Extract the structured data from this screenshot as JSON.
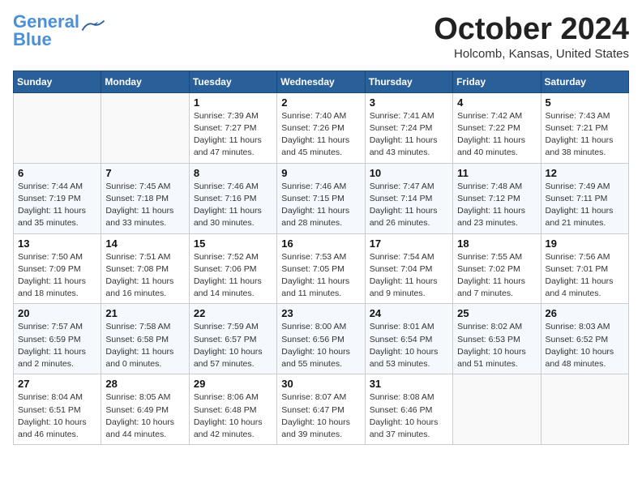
{
  "header": {
    "logo_line1": "General",
    "logo_line2": "Blue",
    "month": "October 2024",
    "location": "Holcomb, Kansas, United States"
  },
  "days_of_week": [
    "Sunday",
    "Monday",
    "Tuesday",
    "Wednesday",
    "Thursday",
    "Friday",
    "Saturday"
  ],
  "weeks": [
    [
      {
        "day": "",
        "info": ""
      },
      {
        "day": "",
        "info": ""
      },
      {
        "day": "1",
        "info": "Sunrise: 7:39 AM\nSunset: 7:27 PM\nDaylight: 11 hours and 47 minutes."
      },
      {
        "day": "2",
        "info": "Sunrise: 7:40 AM\nSunset: 7:26 PM\nDaylight: 11 hours and 45 minutes."
      },
      {
        "day": "3",
        "info": "Sunrise: 7:41 AM\nSunset: 7:24 PM\nDaylight: 11 hours and 43 minutes."
      },
      {
        "day": "4",
        "info": "Sunrise: 7:42 AM\nSunset: 7:22 PM\nDaylight: 11 hours and 40 minutes."
      },
      {
        "day": "5",
        "info": "Sunrise: 7:43 AM\nSunset: 7:21 PM\nDaylight: 11 hours and 38 minutes."
      }
    ],
    [
      {
        "day": "6",
        "info": "Sunrise: 7:44 AM\nSunset: 7:19 PM\nDaylight: 11 hours and 35 minutes."
      },
      {
        "day": "7",
        "info": "Sunrise: 7:45 AM\nSunset: 7:18 PM\nDaylight: 11 hours and 33 minutes."
      },
      {
        "day": "8",
        "info": "Sunrise: 7:46 AM\nSunset: 7:16 PM\nDaylight: 11 hours and 30 minutes."
      },
      {
        "day": "9",
        "info": "Sunrise: 7:46 AM\nSunset: 7:15 PM\nDaylight: 11 hours and 28 minutes."
      },
      {
        "day": "10",
        "info": "Sunrise: 7:47 AM\nSunset: 7:14 PM\nDaylight: 11 hours and 26 minutes."
      },
      {
        "day": "11",
        "info": "Sunrise: 7:48 AM\nSunset: 7:12 PM\nDaylight: 11 hours and 23 minutes."
      },
      {
        "day": "12",
        "info": "Sunrise: 7:49 AM\nSunset: 7:11 PM\nDaylight: 11 hours and 21 minutes."
      }
    ],
    [
      {
        "day": "13",
        "info": "Sunrise: 7:50 AM\nSunset: 7:09 PM\nDaylight: 11 hours and 18 minutes."
      },
      {
        "day": "14",
        "info": "Sunrise: 7:51 AM\nSunset: 7:08 PM\nDaylight: 11 hours and 16 minutes."
      },
      {
        "day": "15",
        "info": "Sunrise: 7:52 AM\nSunset: 7:06 PM\nDaylight: 11 hours and 14 minutes."
      },
      {
        "day": "16",
        "info": "Sunrise: 7:53 AM\nSunset: 7:05 PM\nDaylight: 11 hours and 11 minutes."
      },
      {
        "day": "17",
        "info": "Sunrise: 7:54 AM\nSunset: 7:04 PM\nDaylight: 11 hours and 9 minutes."
      },
      {
        "day": "18",
        "info": "Sunrise: 7:55 AM\nSunset: 7:02 PM\nDaylight: 11 hours and 7 minutes."
      },
      {
        "day": "19",
        "info": "Sunrise: 7:56 AM\nSunset: 7:01 PM\nDaylight: 11 hours and 4 minutes."
      }
    ],
    [
      {
        "day": "20",
        "info": "Sunrise: 7:57 AM\nSunset: 6:59 PM\nDaylight: 11 hours and 2 minutes."
      },
      {
        "day": "21",
        "info": "Sunrise: 7:58 AM\nSunset: 6:58 PM\nDaylight: 11 hours and 0 minutes."
      },
      {
        "day": "22",
        "info": "Sunrise: 7:59 AM\nSunset: 6:57 PM\nDaylight: 10 hours and 57 minutes."
      },
      {
        "day": "23",
        "info": "Sunrise: 8:00 AM\nSunset: 6:56 PM\nDaylight: 10 hours and 55 minutes."
      },
      {
        "day": "24",
        "info": "Sunrise: 8:01 AM\nSunset: 6:54 PM\nDaylight: 10 hours and 53 minutes."
      },
      {
        "day": "25",
        "info": "Sunrise: 8:02 AM\nSunset: 6:53 PM\nDaylight: 10 hours and 51 minutes."
      },
      {
        "day": "26",
        "info": "Sunrise: 8:03 AM\nSunset: 6:52 PM\nDaylight: 10 hours and 48 minutes."
      }
    ],
    [
      {
        "day": "27",
        "info": "Sunrise: 8:04 AM\nSunset: 6:51 PM\nDaylight: 10 hours and 46 minutes."
      },
      {
        "day": "28",
        "info": "Sunrise: 8:05 AM\nSunset: 6:49 PM\nDaylight: 10 hours and 44 minutes."
      },
      {
        "day": "29",
        "info": "Sunrise: 8:06 AM\nSunset: 6:48 PM\nDaylight: 10 hours and 42 minutes."
      },
      {
        "day": "30",
        "info": "Sunrise: 8:07 AM\nSunset: 6:47 PM\nDaylight: 10 hours and 39 minutes."
      },
      {
        "day": "31",
        "info": "Sunrise: 8:08 AM\nSunset: 6:46 PM\nDaylight: 10 hours and 37 minutes."
      },
      {
        "day": "",
        "info": ""
      },
      {
        "day": "",
        "info": ""
      }
    ]
  ]
}
